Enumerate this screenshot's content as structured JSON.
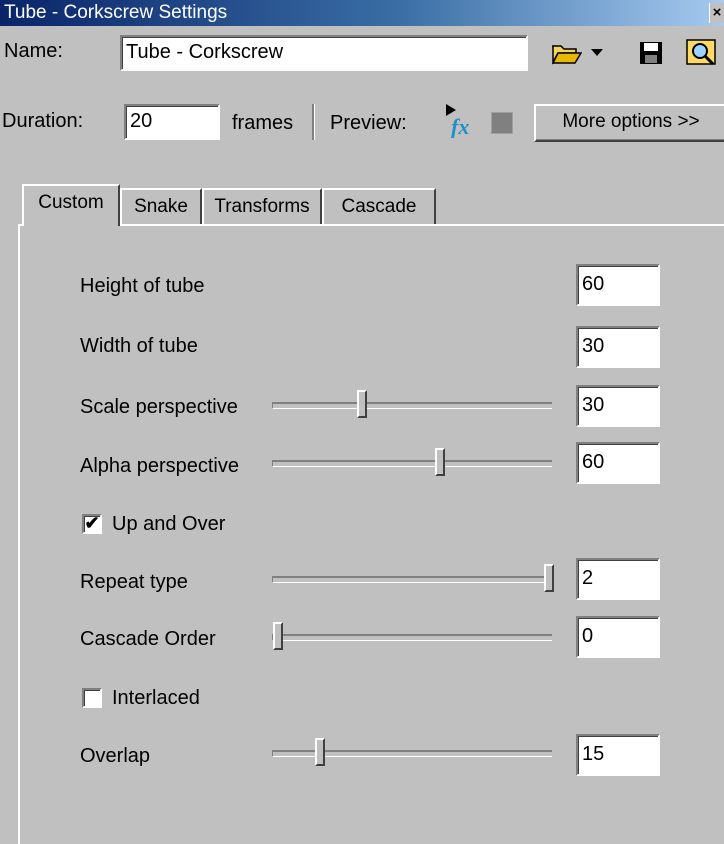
{
  "window": {
    "title": "Tube - Corkscrew Settings",
    "close_icon": "close-icon"
  },
  "header": {
    "name_label": "Name:",
    "name_value": "Tube - Corkscrew",
    "duration_label": "Duration:",
    "duration_value": "20",
    "frames_label": "frames",
    "preview_label": "Preview:",
    "more_options_label": "More options >>",
    "icons": {
      "open": "folder-open-icon",
      "dropdown": "chevron-down-icon",
      "save": "save-icon",
      "zoom": "magnifier-icon",
      "preview_fx": "fx-preview-icon",
      "stop": "stop-icon"
    }
  },
  "tabs": [
    {
      "label": "Custom",
      "active": true
    },
    {
      "label": "Snake",
      "active": false
    },
    {
      "label": "Transforms",
      "active": false
    },
    {
      "label": "Cascade",
      "active": false
    }
  ],
  "settings": {
    "height_of_tube": {
      "label": "Height of tube",
      "value": "60"
    },
    "width_of_tube": {
      "label": "Width of tube",
      "value": "30"
    },
    "scale_perspective": {
      "label": "Scale perspective",
      "value": "30",
      "slider_fraction": 0.32
    },
    "alpha_perspective": {
      "label": "Alpha perspective",
      "value": "60",
      "slider_fraction": 0.6
    },
    "up_and_over": {
      "label": "Up and Over",
      "checked": true
    },
    "repeat_type": {
      "label": "Repeat type",
      "value": "2",
      "slider_fraction": 0.99
    },
    "cascade_order": {
      "label": "Cascade Order",
      "value": "0",
      "slider_fraction": 0.02
    },
    "interlaced": {
      "label": "Interlaced",
      "checked": false
    },
    "overlap": {
      "label": "Overlap",
      "value": "15",
      "slider_fraction": 0.17
    }
  },
  "colors": {
    "face": "#c0c0c0",
    "title_start": "#0a246a",
    "title_end": "#a6caf0"
  }
}
